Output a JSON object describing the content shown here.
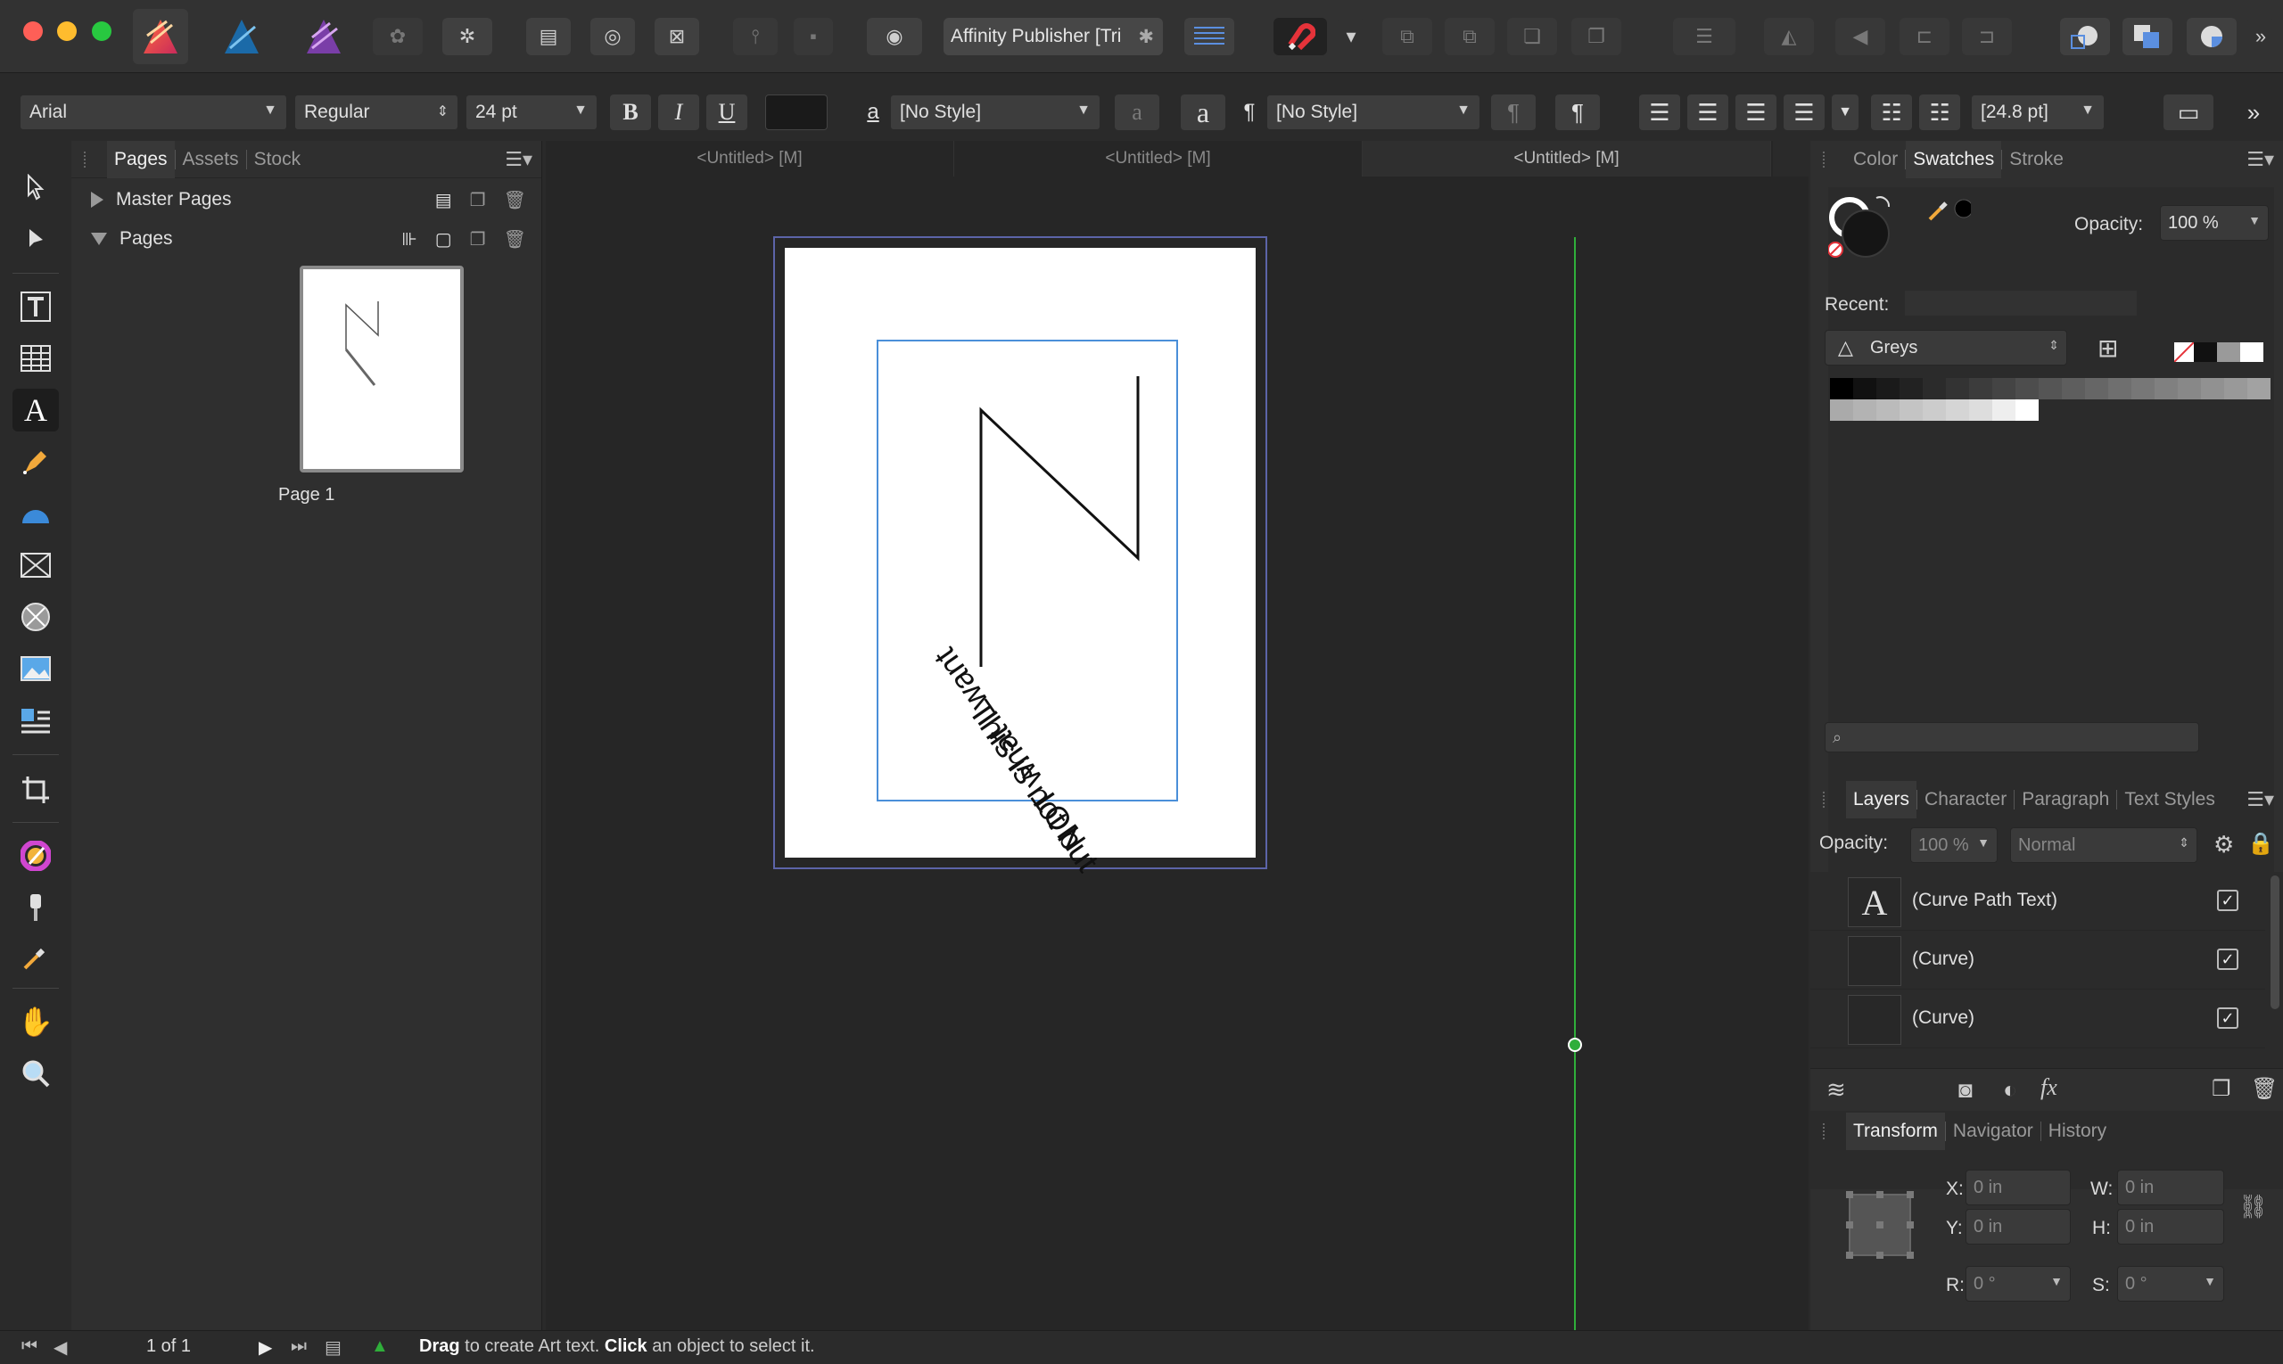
{
  "app": {
    "document_title": "Affinity Publisher [Tri",
    "close_glyph": "✱"
  },
  "context_toolbar": {
    "font_family": "Arial",
    "font_style": "Regular",
    "font_size": "24 pt",
    "bold_label": "B",
    "italic_label": "I",
    "underline_label": "U",
    "char_style_glyph": "a",
    "character_style": "[No Style]",
    "para_glyph": "¶",
    "paragraph_style": "[No Style]",
    "leading": "[24.8 pt]"
  },
  "left_panel": {
    "tabs": [
      "Pages",
      "Assets",
      "Stock"
    ],
    "master_pages_label": "Master Pages",
    "pages_label": "Pages",
    "page_thumb_label": "Page 1"
  },
  "doc_tabs": [
    "<Untitled> [M]",
    "<Untitled> [M]",
    "<Untitled> [M]"
  ],
  "canvas": {
    "path_text_line1": "This is not but",
    "path_text_line2": "NOT what I want"
  },
  "swatches_panel": {
    "tabs": [
      "Color",
      "Swatches",
      "Stroke"
    ],
    "opacity_label": "Opacity:",
    "opacity_value": "100 %",
    "recent_label": "Recent:",
    "palette_name": "Greys",
    "search_placeholder": ""
  },
  "layers_panel": {
    "tabs": [
      "Layers",
      "Character",
      "Paragraph",
      "Text Styles"
    ],
    "opacity_label": "Opacity:",
    "opacity_value": "100 %",
    "blend_mode": "Normal",
    "layers": [
      {
        "name": "(Curve Path Text)",
        "thumb": "A"
      },
      {
        "name": "(Curve)",
        "thumb": ""
      },
      {
        "name": "(Curve)",
        "thumb": ""
      }
    ]
  },
  "transform_panel": {
    "tabs": [
      "Transform",
      "Navigator",
      "History"
    ],
    "x_label": "X:",
    "x_value": "0 in",
    "y_label": "Y:",
    "y_value": "0 in",
    "w_label": "W:",
    "w_value": "0 in",
    "h_label": "H:",
    "h_value": "0 in",
    "r_label": "R:",
    "r_value": "0 °",
    "s_label": "S:",
    "s_value": "0 °"
  },
  "status_bar": {
    "page_indicator": "1 of 1",
    "hint_drag_bold": "Drag",
    "hint_drag_text": " to create Art text. ",
    "hint_click_bold": "Click",
    "hint_click_text": " an object to select it."
  },
  "colors": {
    "accent_blue": "#4a8fd9",
    "guide_green": "#2fae3a",
    "toolbar_bg": "#323232"
  }
}
